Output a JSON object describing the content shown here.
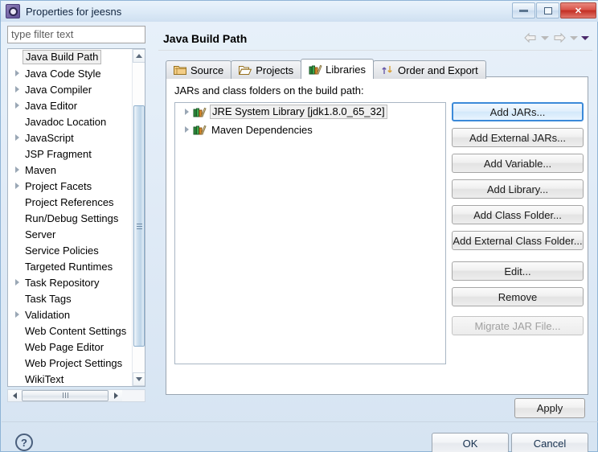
{
  "window": {
    "title": "Properties for jeesns",
    "icon": "eclipse-properties-icon",
    "minimize_label": "Minimize",
    "maximize_label": "Maximize",
    "close_label": "✕"
  },
  "sidebar": {
    "filter": {
      "value": "type filter text",
      "placeholder": "type filter text"
    },
    "items": [
      {
        "label": "Java Build Path",
        "expandable": false,
        "selected": true
      },
      {
        "label": "Java Code Style",
        "expandable": true,
        "selected": false
      },
      {
        "label": "Java Compiler",
        "expandable": true,
        "selected": false
      },
      {
        "label": "Java Editor",
        "expandable": true,
        "selected": false
      },
      {
        "label": "Javadoc Location",
        "expandable": false,
        "selected": false
      },
      {
        "label": "JavaScript",
        "expandable": true,
        "selected": false
      },
      {
        "label": "JSP Fragment",
        "expandable": false,
        "selected": false
      },
      {
        "label": "Maven",
        "expandable": true,
        "selected": false
      },
      {
        "label": "Project Facets",
        "expandable": true,
        "selected": false
      },
      {
        "label": "Project References",
        "expandable": false,
        "selected": false
      },
      {
        "label": "Run/Debug Settings",
        "expandable": false,
        "selected": false
      },
      {
        "label": "Server",
        "expandable": false,
        "selected": false
      },
      {
        "label": "Service Policies",
        "expandable": false,
        "selected": false
      },
      {
        "label": "Targeted Runtimes",
        "expandable": false,
        "selected": false
      },
      {
        "label": "Task Repository",
        "expandable": true,
        "selected": false
      },
      {
        "label": "Task Tags",
        "expandable": false,
        "selected": false
      },
      {
        "label": "Validation",
        "expandable": true,
        "selected": false
      },
      {
        "label": "Web Content Settings",
        "expandable": false,
        "selected": false
      },
      {
        "label": "Web Page Editor",
        "expandable": false,
        "selected": false
      },
      {
        "label": "Web Project Settings",
        "expandable": false,
        "selected": false
      },
      {
        "label": "WikiText",
        "expandable": false,
        "selected": false
      }
    ]
  },
  "page": {
    "title": "Java Build Path",
    "nav": {
      "back_icon": "arrow-left-icon",
      "back_dropdown_icon": "chevron-down-icon",
      "forward_icon": "arrow-right-icon",
      "forward_dropdown_icon": "chevron-down-icon",
      "menu_icon": "chevron-down-filled-icon"
    },
    "tabs": [
      {
        "label": "Source",
        "icon": "source-folder-icon",
        "active": false
      },
      {
        "label": "Projects",
        "icon": "open-folder-icon",
        "active": false
      },
      {
        "label": "Libraries",
        "icon": "books-icon",
        "active": true
      },
      {
        "label": "Order and Export",
        "icon": "order-arrows-icon",
        "active": false
      }
    ],
    "panel": {
      "label": "JARs and class folders on the build path:",
      "entries": [
        {
          "label": "JRE System Library [jdk1.8.0_65_32]",
          "icon": "books-icon",
          "expandable": true,
          "selected": true
        },
        {
          "label": "Maven Dependencies",
          "icon": "books-icon",
          "expandable": true,
          "selected": false
        }
      ],
      "buttons": [
        {
          "label": "Add JARs...",
          "state": "focused"
        },
        {
          "label": "Add External JARs...",
          "state": "normal"
        },
        {
          "label": "Add Variable...",
          "state": "normal"
        },
        {
          "label": "Add Library...",
          "state": "normal"
        },
        {
          "label": "Add Class Folder...",
          "state": "normal"
        },
        {
          "label": "Add External Class Folder...",
          "state": "normal"
        },
        {
          "label": "Edit...",
          "state": "normal"
        },
        {
          "label": "Remove",
          "state": "normal"
        },
        {
          "label": "Migrate JAR File...",
          "state": "disabled"
        }
      ]
    },
    "apply_label": "Apply"
  },
  "footer": {
    "help_icon": "question-mark-icon",
    "help_glyph": "?",
    "ok_label": "OK",
    "cancel_label": "Cancel"
  },
  "colors": {
    "titlebar_start": "#eaf3fb",
    "titlebar_end": "#cfe0f1",
    "close_button": "#c32f24",
    "focus_border": "#3c8ad9",
    "dialog_background": "#dfeaf6",
    "panel_background": "#ffffff"
  }
}
